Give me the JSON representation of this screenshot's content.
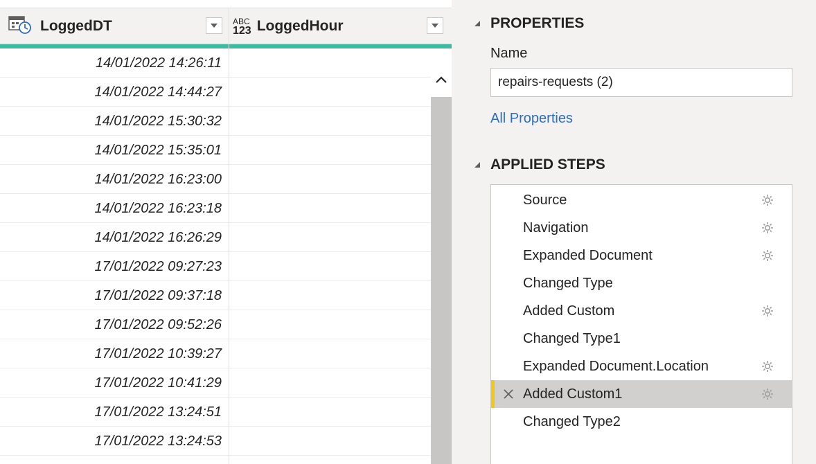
{
  "grid": {
    "columns": [
      {
        "name": "LoggedDT",
        "type_icon": "datetime-type-icon"
      },
      {
        "name": "LoggedHour",
        "type_icon": "any-type-icon",
        "type_text_top": "ABC",
        "type_text_bottom": "123"
      }
    ],
    "rows": [
      {
        "logged_dt": "14/01/2022 14:26:11",
        "logged_hour": ""
      },
      {
        "logged_dt": "14/01/2022 14:44:27",
        "logged_hour": ""
      },
      {
        "logged_dt": "14/01/2022 15:30:32",
        "logged_hour": ""
      },
      {
        "logged_dt": "14/01/2022 15:35:01",
        "logged_hour": ""
      },
      {
        "logged_dt": "14/01/2022 16:23:00",
        "logged_hour": ""
      },
      {
        "logged_dt": "14/01/2022 16:23:18",
        "logged_hour": ""
      },
      {
        "logged_dt": "14/01/2022 16:26:29",
        "logged_hour": ""
      },
      {
        "logged_dt": "17/01/2022 09:27:23",
        "logged_hour": ""
      },
      {
        "logged_dt": "17/01/2022 09:37:18",
        "logged_hour": ""
      },
      {
        "logged_dt": "17/01/2022 09:52:26",
        "logged_hour": ""
      },
      {
        "logged_dt": "17/01/2022 10:39:27",
        "logged_hour": ""
      },
      {
        "logged_dt": "17/01/2022 10:41:29",
        "logged_hour": ""
      },
      {
        "logged_dt": "17/01/2022 13:24:51",
        "logged_hour": ""
      },
      {
        "logged_dt": "17/01/2022 13:24:53",
        "logged_hour": ""
      }
    ],
    "quality_bar_color": "#3bbba1"
  },
  "properties": {
    "section_title": "PROPERTIES",
    "name_label": "Name",
    "name_value": "repairs-requests (2)",
    "all_properties_link": "All Properties",
    "link_color": "#2b6dc2"
  },
  "applied_steps": {
    "section_title": "APPLIED STEPS",
    "steps": [
      {
        "label": "Source",
        "has_settings": true,
        "selected": false
      },
      {
        "label": "Navigation",
        "has_settings": true,
        "selected": false
      },
      {
        "label": "Expanded Document",
        "has_settings": true,
        "selected": false
      },
      {
        "label": "Changed Type",
        "has_settings": false,
        "selected": false
      },
      {
        "label": "Added Custom",
        "has_settings": true,
        "selected": false
      },
      {
        "label": "Changed Type1",
        "has_settings": false,
        "selected": false
      },
      {
        "label": "Expanded Document.Location",
        "has_settings": true,
        "selected": false
      },
      {
        "label": "Added Custom1",
        "has_settings": true,
        "selected": true
      },
      {
        "label": "Changed Type2",
        "has_settings": false,
        "selected": false
      }
    ],
    "selected_accent": "#f2c811"
  }
}
